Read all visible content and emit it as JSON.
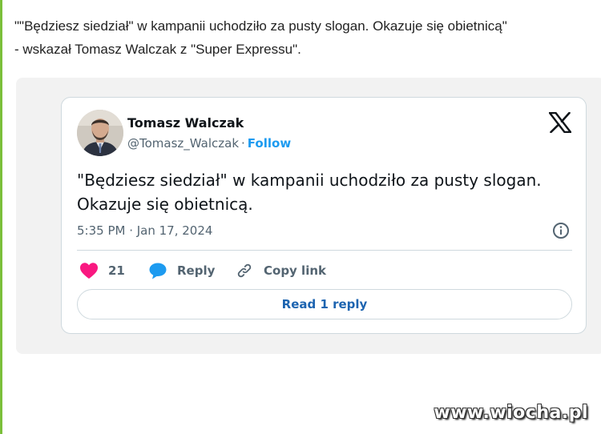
{
  "article": {
    "quote_line1": "\"\"Będziesz siedział\" w kampanii uchodziło za pusty slogan. Okazuje się obietnicą\"",
    "quote_line2": "- wskazał Tomasz Walczak z \"Super Expressu\"."
  },
  "tweet": {
    "author_name": "Tomasz Walczak",
    "handle": "@Tomasz_Walczak",
    "separator": "·",
    "follow_label": "Follow",
    "body_line1": "\"Będziesz siedział\" w kampanii uchodziło za pusty slogan.",
    "body_line2": "Okazuje się obietnicą.",
    "timestamp": "5:35 PM · Jan 17, 2024",
    "like_count": "21",
    "reply_label": "Reply",
    "copy_link_label": "Copy link",
    "read_replies_label": "Read 1 reply",
    "icons": {
      "platform": "x-logo-icon",
      "info": "info-icon",
      "like": "heart-icon",
      "reply": "speech-bubble-icon",
      "copy": "link-icon"
    },
    "colors": {
      "like": "#f91880",
      "reply": "#1d9bf0",
      "follow": "#1d9bf0"
    }
  },
  "watermark": "www.wiocha.pl"
}
